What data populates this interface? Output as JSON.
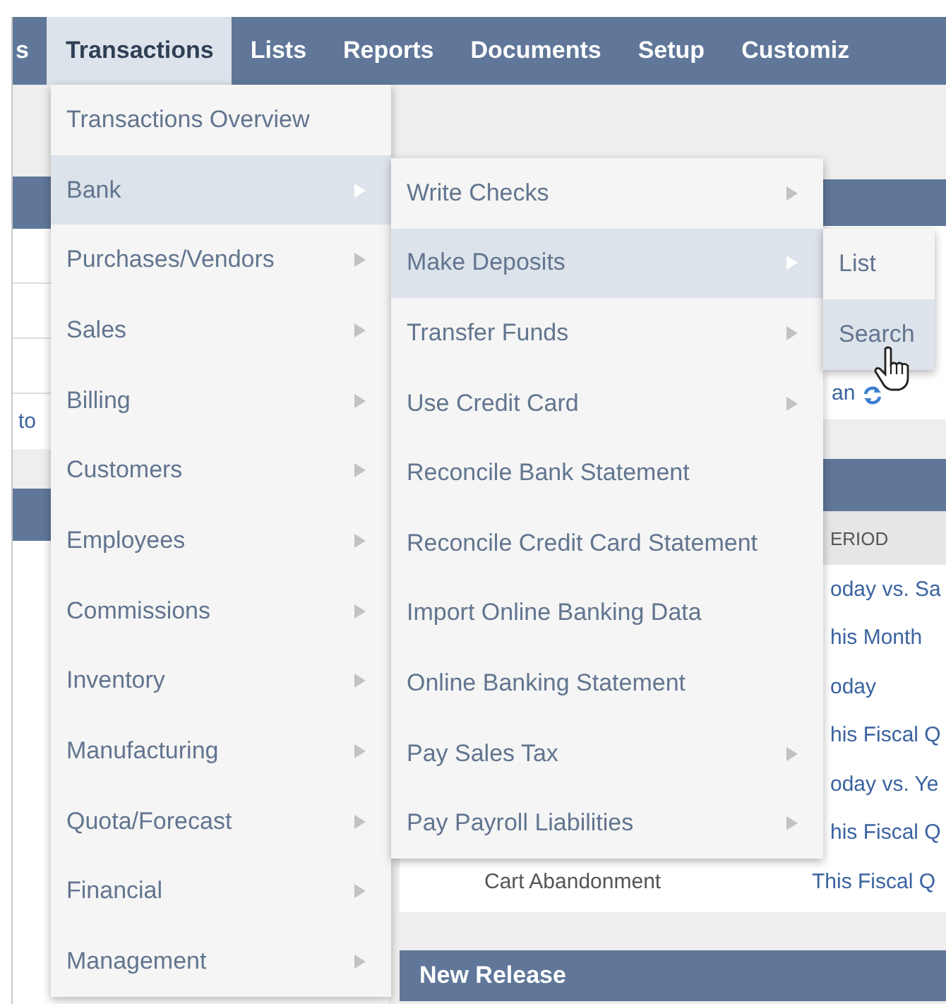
{
  "nav": [
    {
      "label": "s",
      "selected": false
    },
    {
      "label": "Transactions",
      "selected": true
    },
    {
      "label": "Lists",
      "selected": false
    },
    {
      "label": "Reports",
      "selected": false
    },
    {
      "label": "Documents",
      "selected": false
    },
    {
      "label": "Setup",
      "selected": false
    },
    {
      "label": "Customiz",
      "selected": false
    }
  ],
  "menu": {
    "items": [
      {
        "label": "Transactions Overview",
        "has_submenu": false,
        "selected": false
      },
      {
        "label": "Bank",
        "has_submenu": true,
        "selected": true
      },
      {
        "label": "Purchases/Vendors",
        "has_submenu": true,
        "selected": false
      },
      {
        "label": "Sales",
        "has_submenu": true,
        "selected": false
      },
      {
        "label": "Billing",
        "has_submenu": true,
        "selected": false
      },
      {
        "label": "Customers",
        "has_submenu": true,
        "selected": false
      },
      {
        "label": "Employees",
        "has_submenu": true,
        "selected": false
      },
      {
        "label": "Commissions",
        "has_submenu": true,
        "selected": false
      },
      {
        "label": "Inventory",
        "has_submenu": true,
        "selected": false
      },
      {
        "label": "Manufacturing",
        "has_submenu": true,
        "selected": false
      },
      {
        "label": "Quota/Forecast",
        "has_submenu": true,
        "selected": false
      },
      {
        "label": "Financial",
        "has_submenu": true,
        "selected": false
      },
      {
        "label": "Management",
        "has_submenu": true,
        "selected": false
      }
    ]
  },
  "submenu": {
    "items": [
      {
        "label": "Write Checks",
        "has_submenu": true,
        "selected": false
      },
      {
        "label": "Make Deposits",
        "has_submenu": true,
        "selected": true
      },
      {
        "label": "Transfer Funds",
        "has_submenu": true,
        "selected": false
      },
      {
        "label": "Use Credit Card",
        "has_submenu": true,
        "selected": false
      },
      {
        "label": "Reconcile Bank Statement",
        "has_submenu": false,
        "selected": false
      },
      {
        "label": "Reconcile Credit Card Statement",
        "has_submenu": false,
        "selected": false
      },
      {
        "label": "Import Online Banking Data",
        "has_submenu": false,
        "selected": false
      },
      {
        "label": "Online Banking Statement",
        "has_submenu": false,
        "selected": false
      },
      {
        "label": "Pay Sales Tax",
        "has_submenu": true,
        "selected": false
      },
      {
        "label": "Pay Payroll Liabilities",
        "has_submenu": true,
        "selected": false
      }
    ]
  },
  "submenu_2": {
    "items": [
      {
        "label": "List",
        "selected": false
      },
      {
        "label": "Search",
        "selected": true
      }
    ]
  },
  "dashboard": {
    "left_panel": {
      "link": "to"
    },
    "right_panel": {
      "link": "an"
    },
    "table": {
      "column_2_header": "ERIOD",
      "rows": [
        {
          "period": "oday vs. Sa"
        },
        {
          "period": "his Month"
        },
        {
          "period": "oday"
        },
        {
          "period": "his Fiscal Q"
        },
        {
          "period": "oday vs. Ye"
        },
        {
          "period": "his Fiscal Q"
        },
        {
          "name": "Cart Abandonment",
          "period": "This Fiscal Q"
        }
      ]
    },
    "new_release": {
      "title": "New Release"
    }
  }
}
